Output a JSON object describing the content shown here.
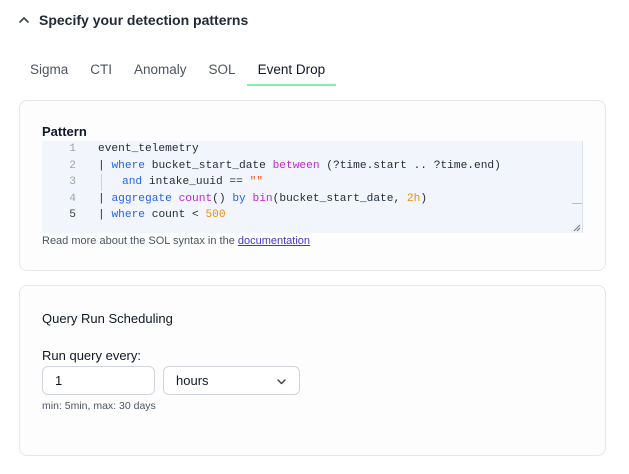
{
  "section": {
    "title": "Specify your detection patterns",
    "icon": "chevron-up-icon"
  },
  "tabs": [
    {
      "label": "Sigma",
      "active": false
    },
    {
      "label": "CTI",
      "active": false
    },
    {
      "label": "Anomaly",
      "active": false
    },
    {
      "label": "SOL",
      "active": false
    },
    {
      "label": "Event Drop",
      "active": true
    }
  ],
  "pattern": {
    "label": "Pattern",
    "line_numbers": [
      "1",
      "2",
      "3",
      "4",
      "5"
    ],
    "hint_text": "Read more about the SOL syntax in the ",
    "hint_link": "documentation"
  },
  "scheduling": {
    "title": "Query Run Scheduling",
    "run_label": "Run query every:",
    "interval_value": "1",
    "unit_value": "hours",
    "limits_text": "min: 5min, max: 30 days"
  },
  "colors": {
    "tab_active_underline": "#86efac",
    "keyword": "#2563eb",
    "function": "#c026d3",
    "number": "#ea8c0c",
    "link": "#4338ca"
  }
}
